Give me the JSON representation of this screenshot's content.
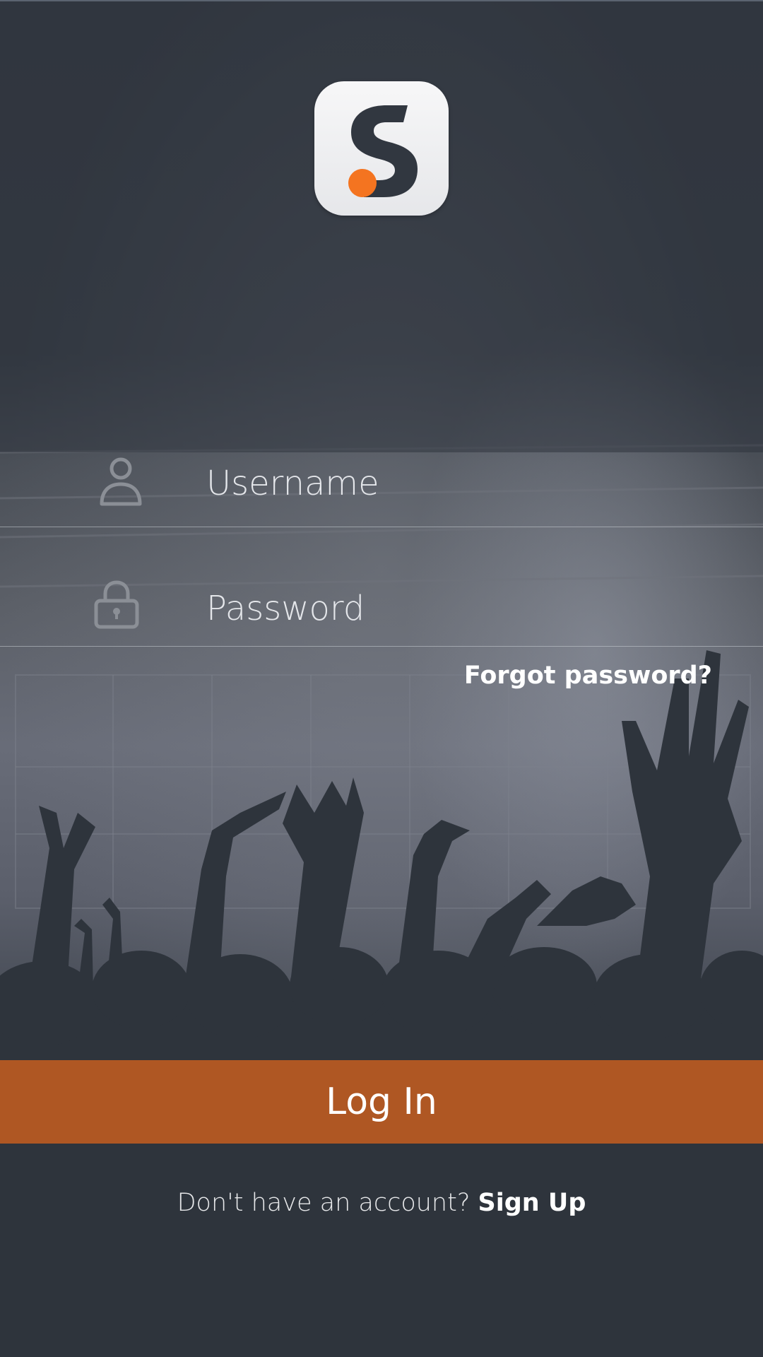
{
  "app": {
    "logo_icon": "s-logo-icon",
    "accent_color": "#f47420",
    "button_color": "#af5723"
  },
  "login_form": {
    "username": {
      "placeholder": "Username",
      "value": "",
      "icon": "user-icon"
    },
    "password": {
      "placeholder": "Password",
      "value": "",
      "icon": "lock-icon"
    },
    "forgot_password_label": "Forgot password?",
    "login_label": "Log In"
  },
  "footer": {
    "prompt": "Don't have an account?",
    "signup_label": "Sign Up"
  }
}
